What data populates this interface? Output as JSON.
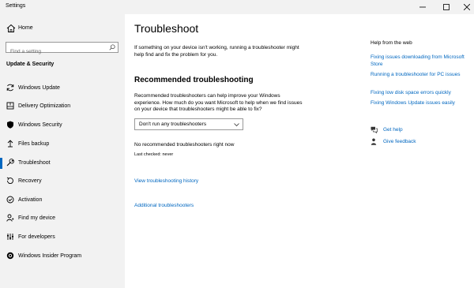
{
  "window": {
    "title": "Settings"
  },
  "sidebar": {
    "home_label": "Home",
    "search_placeholder": "Find a setting",
    "section_title": "Update & Security",
    "items": [
      {
        "label": "Windows Update",
        "icon": "sync-icon"
      },
      {
        "label": "Delivery Optimization",
        "icon": "delivery-optimization-icon"
      },
      {
        "label": "Windows Security",
        "icon": "shield-icon"
      },
      {
        "label": "Files backup",
        "icon": "backup-arrow-icon"
      },
      {
        "label": "Troubleshoot",
        "icon": "wrench-icon",
        "selected": true
      },
      {
        "label": "Recovery",
        "icon": "recovery-icon"
      },
      {
        "label": "Activation",
        "icon": "check-circle-icon"
      },
      {
        "label": "Find my device",
        "icon": "person-location-icon"
      },
      {
        "label": "For developers",
        "icon": "developer-icon"
      },
      {
        "label": "Windows Insider Program",
        "icon": "insider-icon"
      }
    ]
  },
  "main": {
    "title": "Troubleshoot",
    "description": "If something on your device isn't working, running a troubleshooter might help find and fix the problem for you.",
    "recommended_heading": "Recommended troubleshooting",
    "recommended_description": "Recommended troubleshooters can help improve your Windows experience. How much do you want Microsoft to help when we find issues on your device that troubleshooters might be able to fix?",
    "dropdown_value": "Don't run any troubleshooters",
    "status": "No recommended troubleshooters right now",
    "last_checked": "Last checked: never",
    "history_link": "View troubleshooting history",
    "additional_link": "Additional troubleshooters"
  },
  "help": {
    "heading": "Help from the web",
    "links": [
      "Fixing issues downloading from Microsoft Store",
      "Running a troubleshooter for PC issues",
      "Fixing low disk space errors quickly",
      "Fixing Windows Update issues easily"
    ],
    "get_help": "Get help",
    "give_feedback": "Give feedback"
  },
  "colors": {
    "accent": "#0067c0",
    "sidebar_bg": "#f2f2f2"
  }
}
